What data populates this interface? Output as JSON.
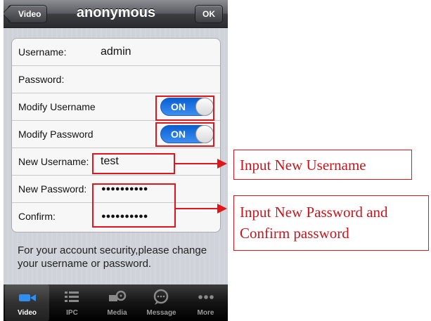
{
  "navbar": {
    "back_label": "Video",
    "title": "anonymous",
    "ok_label": "OK"
  },
  "form": {
    "username_label": "Username:",
    "username_value": "admin",
    "password_label": "Password:",
    "modify_username_label": "Modify Username",
    "modify_username_toggle": "ON",
    "modify_password_label": "Modify Password",
    "modify_password_toggle": "ON",
    "new_username_label": "New Username:",
    "new_username_value": "test",
    "new_password_label": "New Password:",
    "new_password_value": "●●●●●●●●●●",
    "confirm_label": "Confirm:",
    "confirm_value": "●●●●●●●●●●"
  },
  "note": "For your account security,please change your username or password.",
  "tabs": [
    {
      "label": "Video",
      "icon": "video-camera-icon"
    },
    {
      "label": "IPC",
      "icon": "list-icon"
    },
    {
      "label": "Media",
      "icon": "film-reel-icon"
    },
    {
      "label": "Message",
      "icon": "speech-bubble-icon"
    },
    {
      "label": "More",
      "icon": "more-dots-icon"
    }
  ],
  "annotations": {
    "callout_username": "Input New Username",
    "callout_password": "Input New Password and Confirm password"
  },
  "colors": {
    "annotation": "#e0161c",
    "toggle_on": "#1c6fe0",
    "navbar": "#3c3d41"
  }
}
